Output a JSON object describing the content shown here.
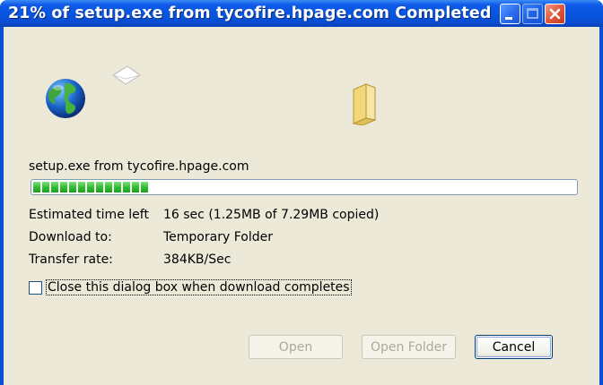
{
  "window": {
    "title": "21% of setup.exe from tycofire.hpage.com Completed",
    "buttons": {
      "minimize": "minimize",
      "maximize": "maximize",
      "close": "close"
    }
  },
  "icons": {
    "source": "globe-icon",
    "transfer": "paper-icon",
    "destination": "folder-icon"
  },
  "download": {
    "source_text": "setup.exe from tycofire.hpage.com",
    "progress": 0.21,
    "rows": [
      {
        "label": "Estimated time left",
        "value": "16 sec (1.25MB of 7.29MB copied)"
      },
      {
        "label": "Download to:",
        "value": "Temporary Folder"
      },
      {
        "label": "Transfer rate:",
        "value": "384KB/Sec"
      }
    ],
    "close_checkbox_label": "Close this dialog box when download completes",
    "close_checked": false
  },
  "buttons": {
    "open": "Open",
    "open_folder": "Open Folder",
    "cancel": "Cancel"
  },
  "colors": {
    "titlebar": "#0a4fd8",
    "client": "#ece9d8",
    "progress": "#2fc02f"
  }
}
